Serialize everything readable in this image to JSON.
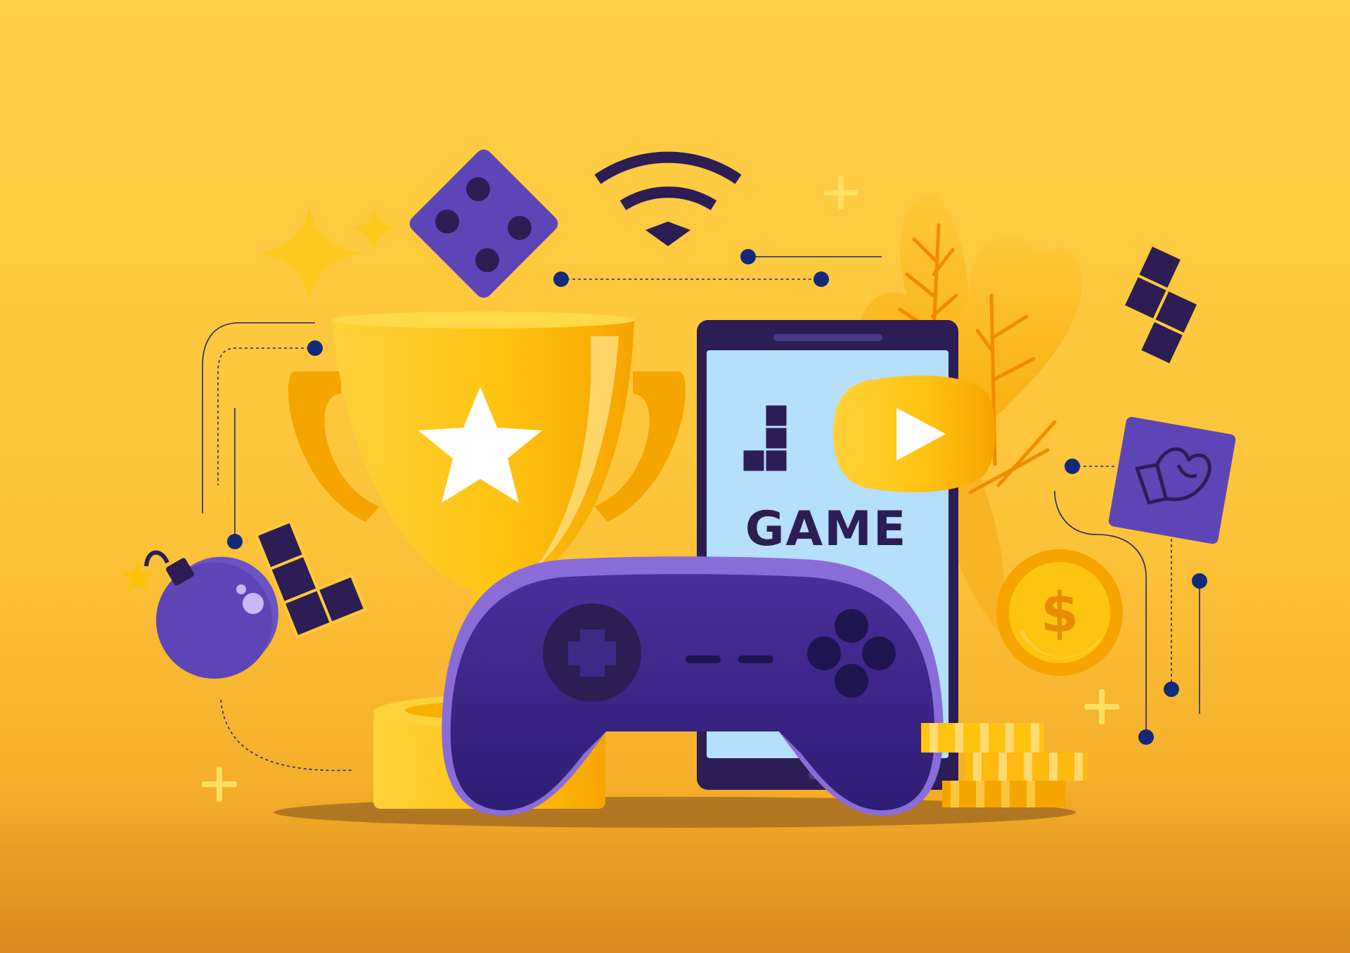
{
  "screen": {
    "game_label": "GAME",
    "currency_symbol": "$"
  },
  "colors": {
    "background": "#FFCF45",
    "purple": "#5E45B5",
    "dark_purple": "#2C1D55",
    "gold": "#FFC107",
    "screen_blue": "#B5DFFA",
    "orange": "#F4A100"
  },
  "icons": [
    "dice-icon",
    "wifi-icon",
    "trophy-icon",
    "star-icon",
    "smartphone-icon",
    "play-button-icon",
    "gamepad-icon",
    "bomb-icon",
    "tetromino-icon",
    "boxing-glove-icon",
    "dollar-coin-icon",
    "coin-stack-icon",
    "sparkle-icon",
    "leaf-icon",
    "plus-icon"
  ]
}
